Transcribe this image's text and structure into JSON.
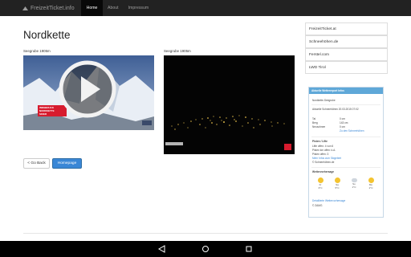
{
  "navbar": {
    "brand": "FreizeitTicket.info",
    "items": [
      {
        "label": "Home",
        "active": true
      },
      {
        "label": "About",
        "active": false
      },
      {
        "label": "Impressum",
        "active": false
      }
    ]
  },
  "page": {
    "title": "Nordkette",
    "cam1_label": "Seegrube 1905m",
    "cam2_label": "Seegrube 1905m",
    "cam1_badge_line1": "INNSBRUCK",
    "cam1_badge_line2": "NORDKETTE",
    "cam1_badge_line3": "SKIER",
    "back_button": "< Go Back",
    "home_button": "Homepage"
  },
  "sidebar": {
    "links": [
      "FreizeitTicket.at",
      "Schneehöhen.de",
      "Ferstel.com",
      "LWD Tirol"
    ],
    "info": {
      "heading": "Aktuelle Wetterreport Infos",
      "location": "Nordkette-Seegrube",
      "updated": "Aktuelle Schneehöhen 20.03.2015 07:02",
      "rows": [
        {
          "label": "Tal",
          "value": "0 cm"
        },
        {
          "label": "Berg",
          "value": "143 cm"
        },
        {
          "label": "Neuschnee",
          "value": "0 cm"
        }
      ],
      "snow_link": "Zu den Schneehöhen",
      "slopes_heading": "Pisten / Lifte",
      "slopes": [
        "Lifte offen: 4 von 6",
        "Pisten km offen: k.A.",
        "Pisten offen: 3"
      ],
      "slopes_link": "Mehr Infos zum Skigebiet",
      "slopes_source": "© Schneehöhen.de",
      "weather_heading": "Wettervorhersage",
      "forecast": [
        {
          "day": "Fr",
          "temp": "3°C",
          "icon": "sun"
        },
        {
          "day": "Sa",
          "temp": "5°C",
          "icon": "sun"
        },
        {
          "day": "So",
          "temp": "1°C",
          "icon": "cloud"
        },
        {
          "day": "Mo",
          "temp": "1°C",
          "icon": "sun"
        }
      ],
      "weather_link": "Detaillierte Wettervorhersage",
      "weather_source": "© ZAMG"
    }
  },
  "colors": {
    "navbar": "#222222",
    "primary": "#3a87d6",
    "info_header": "#5fa8d8"
  }
}
